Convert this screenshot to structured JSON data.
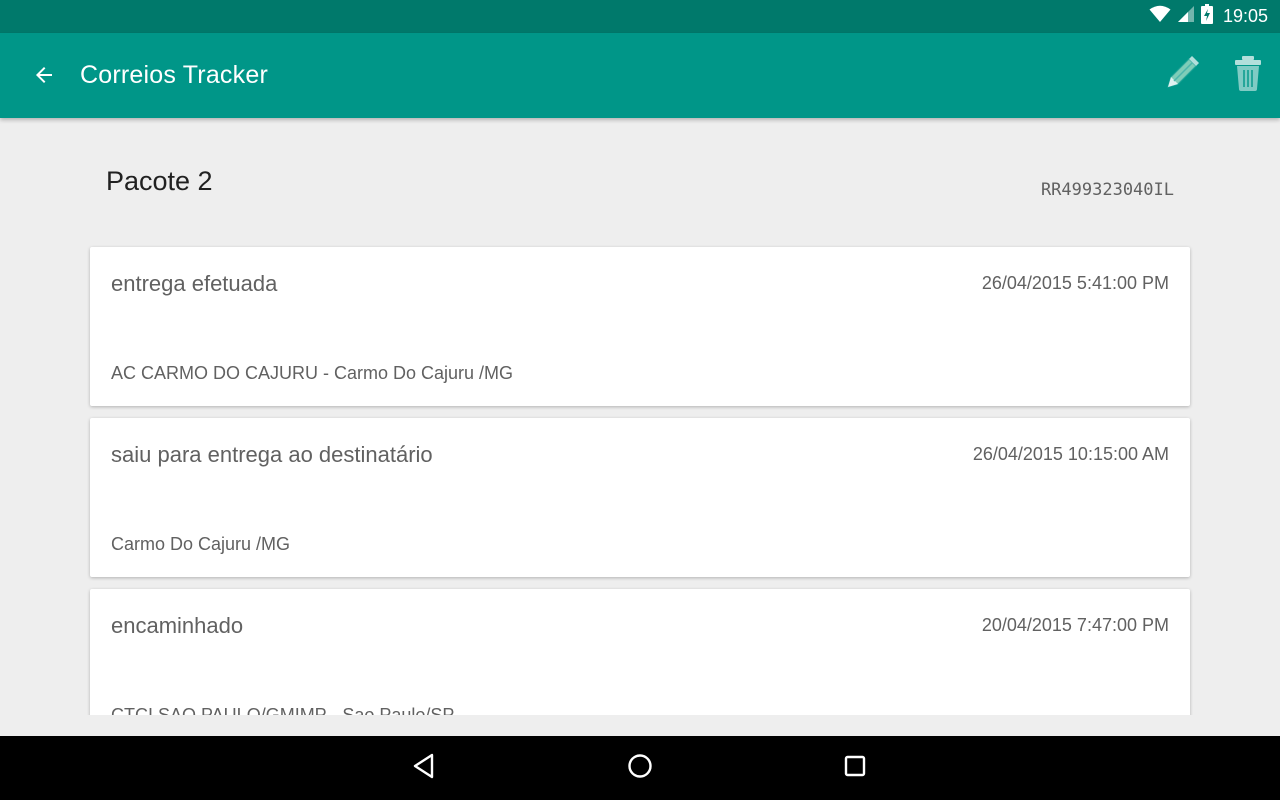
{
  "status_bar": {
    "time": "19:05",
    "icons": [
      "wifi-icon",
      "cell-signal-icon",
      "battery-charging-icon"
    ]
  },
  "app_bar": {
    "title": "Correios Tracker",
    "background": "#009688",
    "status_background": "#00796b",
    "actions": [
      "back-arrow-icon",
      "pencil-edit-icon",
      "trash-delete-icon"
    ]
  },
  "package": {
    "name": "Pacote 2",
    "tracking_code": "RR499323040IL"
  },
  "events": [
    {
      "status": "entrega efetuada",
      "datetime": "26/04/2015 5:41:00 PM",
      "location": "AC CARMO DO CAJURU - Carmo Do Cajuru /MG"
    },
    {
      "status": "saiu para entrega ao destinatário",
      "datetime": "26/04/2015 10:15:00 AM",
      "location": "Carmo Do Cajuru /MG"
    },
    {
      "status": "encaminhado",
      "datetime": "20/04/2015 7:47:00 PM",
      "location": "CTCI SAO PAULO/GMIMP - Sao Paulo/SP"
    }
  ],
  "nav_bar": {
    "buttons": [
      "nav-back-icon",
      "nav-home-icon",
      "nav-recents-icon"
    ]
  }
}
